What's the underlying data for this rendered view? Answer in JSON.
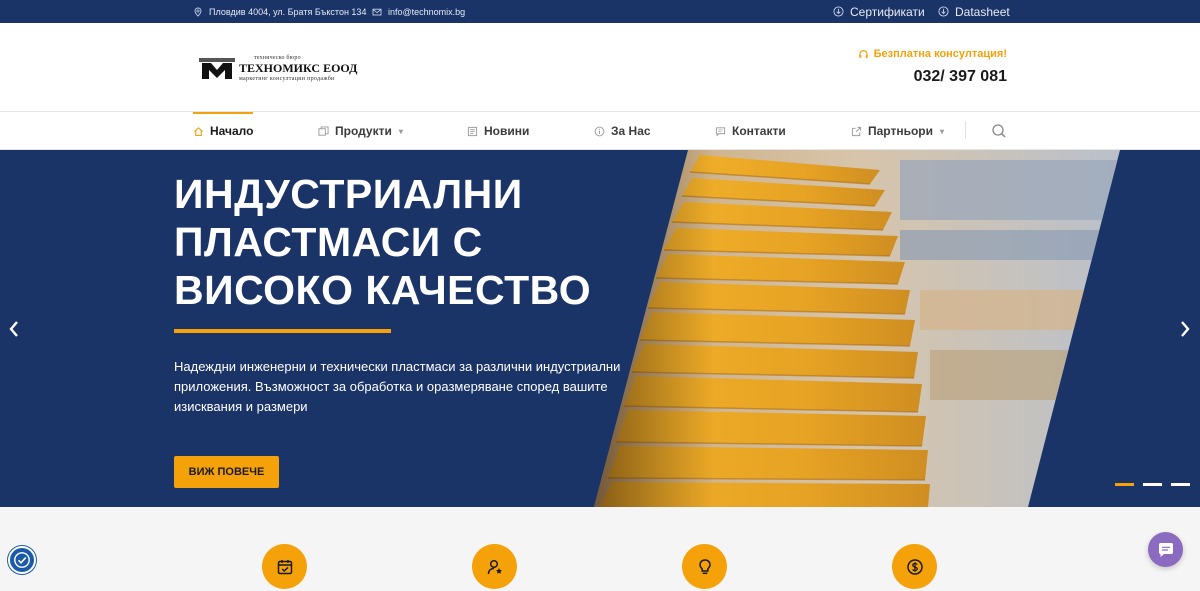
{
  "topbar": {
    "address": "Пловдив 4004, ул. Братя Бъкстон 134",
    "email": "info@technomix.bg",
    "certificates": "Сертификати",
    "datasheet": "Datasheet"
  },
  "header": {
    "logo_small": "техническо бюро",
    "logo_name": "ТЕХНОМИКС ЕООД",
    "logo_sub": "маркетинг  консултации  продажби",
    "consult_label": "Безплатна консултация!",
    "phone": "032/ 397 081"
  },
  "nav": {
    "items": [
      {
        "label": "Начало",
        "icon": "home-icon",
        "active": true
      },
      {
        "label": "Продукти",
        "icon": "products-icon",
        "dropdown": true
      },
      {
        "label": "Новини",
        "icon": "news-icon"
      },
      {
        "label": "За Нас",
        "icon": "info-icon"
      },
      {
        "label": "Контакти",
        "icon": "chat-bubble-icon"
      },
      {
        "label": "Партньори",
        "icon": "external-link-icon",
        "dropdown": true
      }
    ],
    "search_icon": "search-icon"
  },
  "hero": {
    "title_line1": "ИНДУСТРИАЛНИ",
    "title_line2": "ПЛАСТМАСИ С",
    "title_line3": "ВИСОКО КАЧЕСТВО",
    "description": "Надеждни инженерни и технически пластмаси за различни индустриални приложения. Възможност за обработка и оразмеряване според вашите изисквания и размери",
    "button": "ВИЖ ПОВЕЧЕ",
    "slide_count": 3,
    "active_slide": 1
  },
  "features": {
    "icons": [
      "calendar-check-icon",
      "user-star-icon",
      "lightbulb-icon",
      "dollar-coin-icon"
    ]
  },
  "widgets": {
    "accessibility_icon": "accessibility-icon",
    "chat_icon": "chat-icon"
  },
  "colors": {
    "brand_navy": "#1a3468",
    "accent_orange": "#f5a20a"
  }
}
